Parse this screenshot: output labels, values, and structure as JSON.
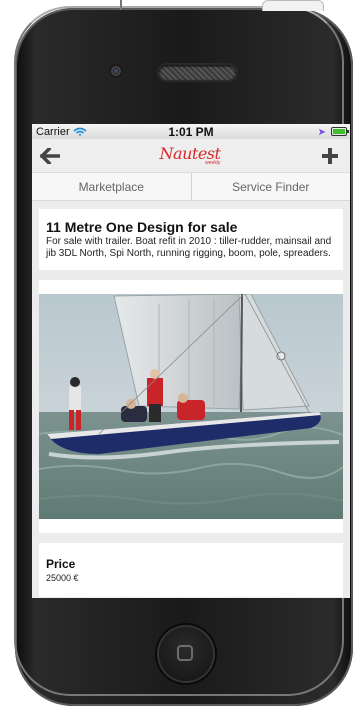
{
  "status_bar": {
    "carrier": "Carrier",
    "time": "1:01 PM"
  },
  "nav": {
    "logo": "Nautest",
    "logo_tagline": "weekly"
  },
  "tabs": [
    {
      "label": "Marketplace"
    },
    {
      "label": "Service Finder"
    }
  ],
  "listing": {
    "title": "11 Metre One Design for sale",
    "description": "For sale with trailer. Boat refit in 2010 : tiller-rudder, mainsail and jib 3DL North, Spi North, running rigging, boom, pole, spreaders.",
    "price_label": "Price",
    "price_value": "25000 €"
  },
  "colors": {
    "brand": "#d62b2b",
    "hull": "#1e2c6a",
    "sea": "#6f8a86"
  }
}
